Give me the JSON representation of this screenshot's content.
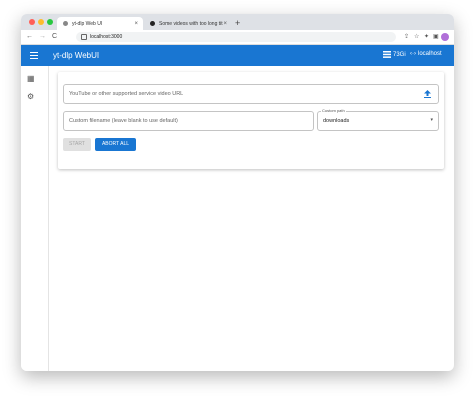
{
  "browser": {
    "tabs": [
      {
        "label": "yt-dlp Web UI",
        "close": "×"
      },
      {
        "label": "Some videos with too long tit…",
        "close": "×"
      }
    ],
    "new_tab": "+",
    "nav": {
      "back": "←",
      "forward": "→",
      "reload": "C"
    },
    "url": "localhost:3000"
  },
  "app": {
    "title": "yt-dlp WebUI",
    "status": {
      "disk": "73Gi",
      "host": "localhost"
    }
  },
  "form": {
    "url_placeholder": "YouTube or other supported service video URL",
    "filename_placeholder": "Custom filename (leave blank to use default)",
    "path_label": "Custom path",
    "path_value": "downloads",
    "start_label": "START",
    "abort_label": "ABORT ALL"
  },
  "colors": {
    "primary": "#1976d2",
    "tabstrip": "#dee1e6",
    "disabled_bg": "#e0e0e0"
  }
}
